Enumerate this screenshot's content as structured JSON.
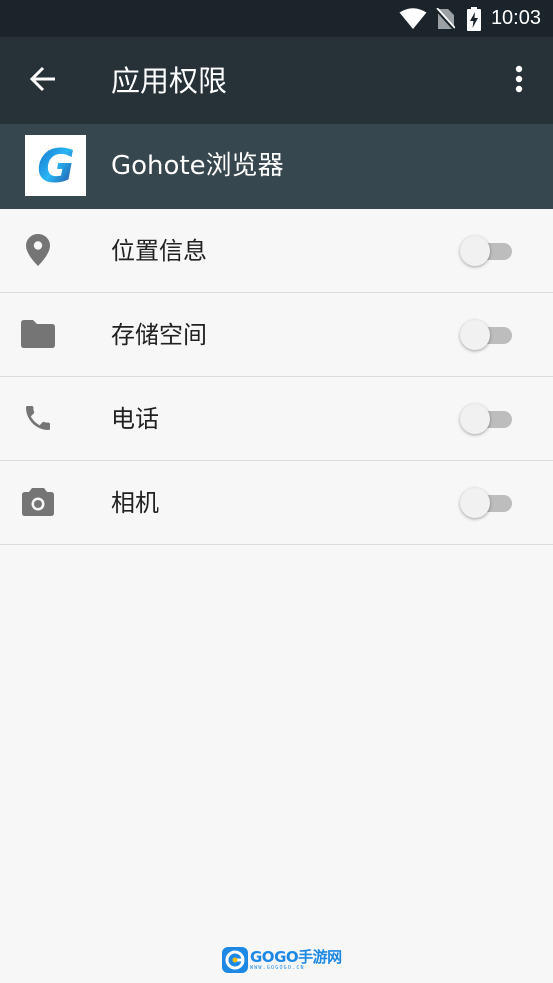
{
  "status_bar": {
    "time": "10:03",
    "icons": [
      "wifi-icon",
      "no-sim-icon",
      "battery-charging-icon"
    ]
  },
  "app_bar": {
    "title": "应用权限",
    "back_icon": "arrow-back-icon",
    "menu_icon": "more-vert-icon"
  },
  "app_header": {
    "app_name": "Gohote浏览器",
    "app_icon": "gohote-logo",
    "icon_letter": "G"
  },
  "permissions": [
    {
      "label": "位置信息",
      "icon": "location-pin-icon",
      "enabled": false
    },
    {
      "label": "存储空间",
      "icon": "folder-icon",
      "enabled": false
    },
    {
      "label": "电话",
      "icon": "phone-icon",
      "enabled": false
    },
    {
      "label": "相机",
      "icon": "camera-icon",
      "enabled": false
    }
  ],
  "watermark": {
    "brand": "GOGO手游网",
    "url": "WWW.GOGOGO.CN"
  },
  "colors": {
    "status_bar": "#1c242b",
    "app_bar": "#263238",
    "app_header": "#37474f",
    "background": "#f7f7f7",
    "icon_gray": "#757575",
    "toggle_track_off": "#bdbdbd",
    "toggle_thumb_off": "#f1f1f1",
    "brand_blue": "#1e88e5"
  }
}
